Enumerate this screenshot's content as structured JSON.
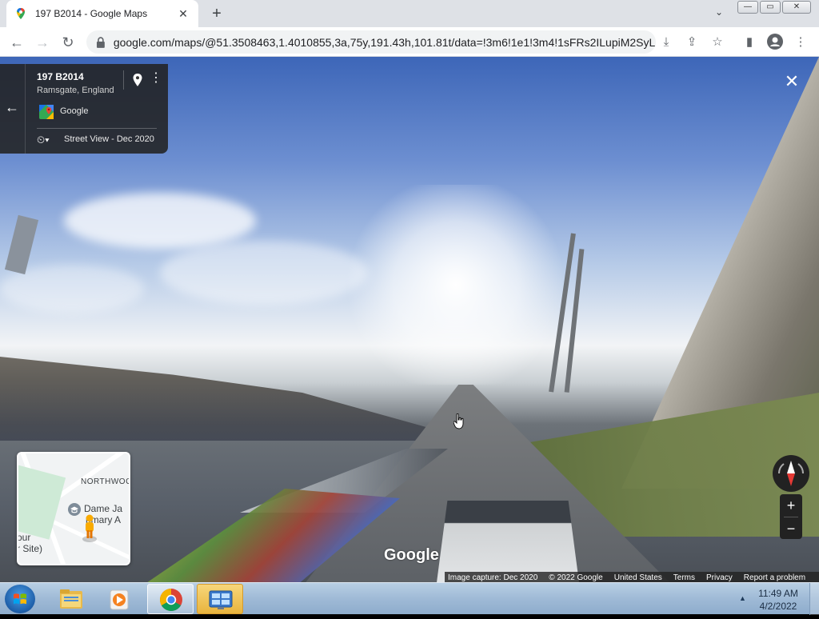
{
  "browser": {
    "tab_title": "197 B2014 - Google Maps",
    "tab_close": "✕",
    "new_tab": "+",
    "tab_search": "⌄",
    "url": "google.com/maps/@51.3508463,1.4010855,3a,75y,191.43h,101.81t/data=!3m6!1e1!3m4!1sFRs2ILupiM2SyL...",
    "window_controls": [
      "—",
      "▭",
      "✕"
    ]
  },
  "toolbar": {
    "back": "←",
    "forward": "→",
    "reload": "↻",
    "install": "⤓",
    "share": "⇪",
    "bookmark": "☆",
    "side_panel": "▮",
    "menu": "⋮"
  },
  "street_view": {
    "place_title": "197 B2014",
    "place_subtitle": "Ramsgate, England",
    "provider": "Google",
    "date_label": "Street View - Dec 2020",
    "back_arrow": "←",
    "more": "⋮",
    "time_icon": "⏲▾",
    "exit": "✕",
    "watermark": "Google"
  },
  "minimap": {
    "labels": [
      "NORTHWOO",
      "Dame Ja",
      "rimary A",
      "our",
      "r Site)"
    ]
  },
  "controls": {
    "zoom_in": "+",
    "zoom_out": "−"
  },
  "footer": {
    "items": [
      "Image capture: Dec 2020",
      "© 2022 Google",
      "United States",
      "Terms",
      "Privacy",
      "Report a problem"
    ]
  },
  "taskbar": {
    "time": "11:49 AM",
    "date": "4/2/2022",
    "tray_arrow": "▲"
  },
  "icons": {
    "tab_favicon": "google-maps-icon",
    "pin": "map-pin-icon",
    "logo": "google-maps-logo",
    "compass": "compass-icon",
    "pegman": "pegman-icon",
    "school": "school-icon",
    "start": "windows-start-icon",
    "explorer": "folder-icon",
    "media": "media-player-icon",
    "chrome": "chrome-icon",
    "control_panel": "control-panel-icon"
  },
  "colors": {
    "card_bg": "#222222",
    "tab_bg": "#ffffff",
    "tabbar_bg": "#dee1e6",
    "taskbar": "#9fbad6",
    "compass_red": "#e53935"
  }
}
